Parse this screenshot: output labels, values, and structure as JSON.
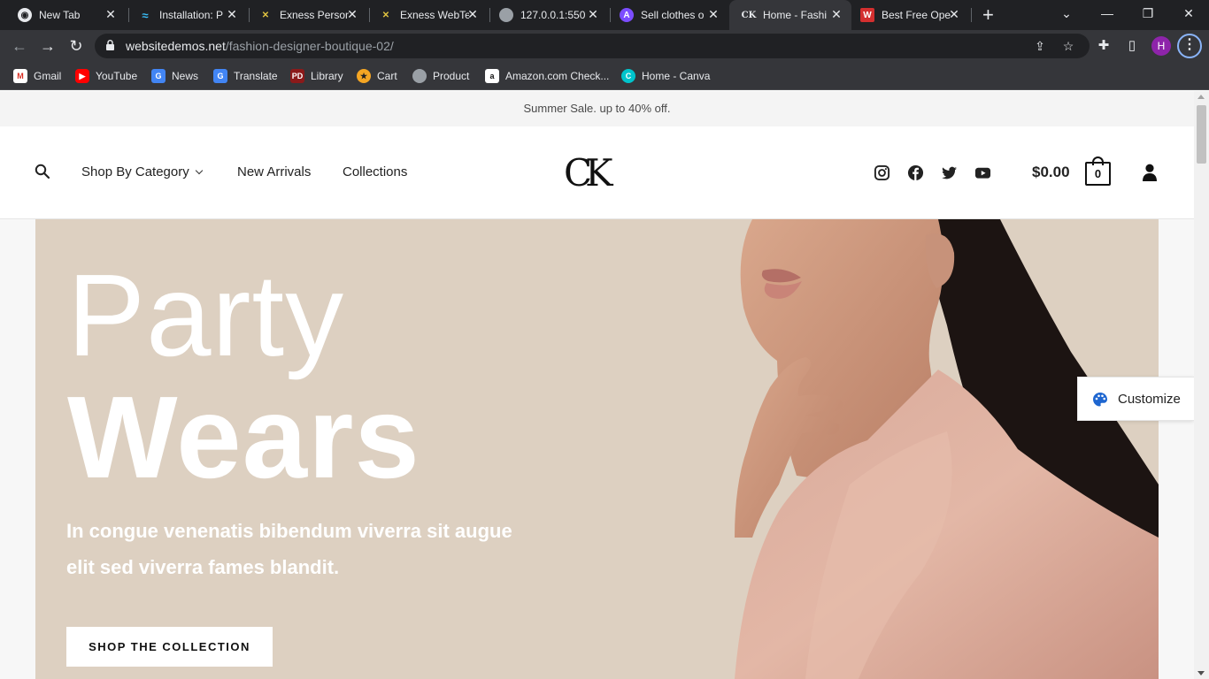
{
  "browser": {
    "tabs": [
      {
        "title": "New Tab",
        "favicon": "chrome-icon",
        "active": false
      },
      {
        "title": "Installation: P",
        "favicon": "tailwind-icon",
        "active": false
      },
      {
        "title": "Exness Person",
        "favicon": "exness-icon",
        "active": false
      },
      {
        "title": "Exness WebTe",
        "favicon": "exness-icon",
        "active": false
      },
      {
        "title": "127.0.0.1:550",
        "favicon": "globe-icon",
        "active": false
      },
      {
        "title": "Sell clothes o",
        "favicon": "arc-icon",
        "active": false
      },
      {
        "title": "Home - Fashi",
        "favicon": "ck-icon",
        "active": true
      },
      {
        "title": "Best Free Ope",
        "favicon": "w-icon",
        "active": false
      }
    ],
    "url_host": "websitedemos.net",
    "url_path": "/fashion-designer-boutique-02/",
    "profile_initial": "H",
    "bookmarks": [
      {
        "label": "Gmail",
        "icon": "gmail-icon"
      },
      {
        "label": "YouTube",
        "icon": "youtube-icon"
      },
      {
        "label": "News",
        "icon": "news-icon"
      },
      {
        "label": "Translate",
        "icon": "translate-icon"
      },
      {
        "label": "Library",
        "icon": "library-icon"
      },
      {
        "label": "Cart",
        "icon": "cart-icon"
      },
      {
        "label": "Product",
        "icon": "globe-icon"
      },
      {
        "label": "Amazon.com Check...",
        "icon": "amazon-icon"
      },
      {
        "label": "Home - Canva",
        "icon": "canva-icon"
      }
    ]
  },
  "site": {
    "promo": "Summer Sale. up to 40% off.",
    "nav": {
      "shop_by_category": "Shop By Category",
      "new_arrivals": "New Arrivals",
      "collections": "Collections"
    },
    "logo": "CK",
    "cart_total": "$0.00",
    "cart_count": "0",
    "hero": {
      "title_line1": "Party",
      "title_line2": "Wears",
      "subtitle": "In congue venenatis bibendum viverra sit augue elit sed viverra fames blandit.",
      "button": "SHOP THE COLLECTION"
    },
    "customize_label": "Customize"
  },
  "colors": {
    "hero_bg": "#ddd0c1",
    "chrome_dark": "#202124",
    "chrome_toolbar": "#35363a"
  }
}
